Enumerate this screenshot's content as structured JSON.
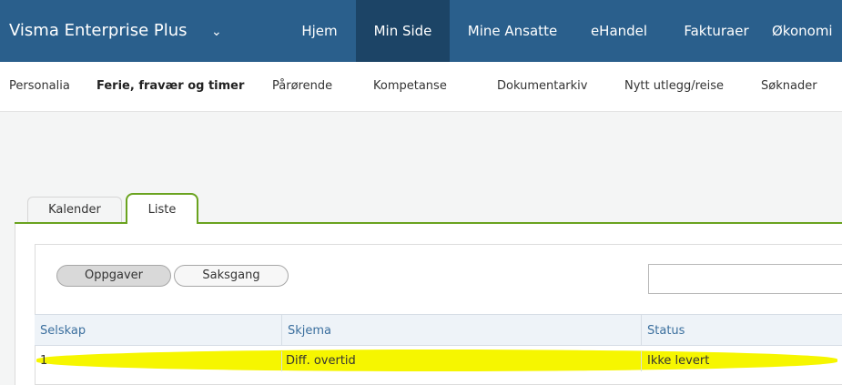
{
  "topbar": {
    "brand": "Visma Enterprise Plus",
    "brand_chevron": "⌄",
    "nav": [
      "Hjem",
      "Min Side",
      "Mine Ansatte",
      "eHandel",
      "Fakturaer",
      "Økonomi"
    ],
    "active": "Min Side",
    "bg_color": "#2a5f8c",
    "active_color": "#1c4466"
  },
  "subnav": {
    "items": [
      "Personalia",
      "Ferie, fravær og timer",
      "Pårørende",
      "Kompetanse",
      "Dokumentarkiv",
      "Nytt utlegg/reise",
      "Søknader"
    ],
    "active": "Ferie, fravær og timer"
  },
  "tabs": {
    "items": [
      "Kalender",
      "Liste"
    ],
    "active": "Liste",
    "accent_color": "#6aa31f"
  },
  "toggle": {
    "items": [
      "Oppgaver",
      "Saksgang"
    ],
    "active": "Oppgaver"
  },
  "search": {
    "value": "",
    "placeholder": ""
  },
  "table": {
    "columns": [
      "Selskap",
      "Skjema",
      "Status"
    ],
    "rows": [
      {
        "selskap": "1",
        "skjema": "Diff. overtid",
        "status": "Ikke levert"
      }
    ],
    "highlight_color": "#f6f600"
  }
}
